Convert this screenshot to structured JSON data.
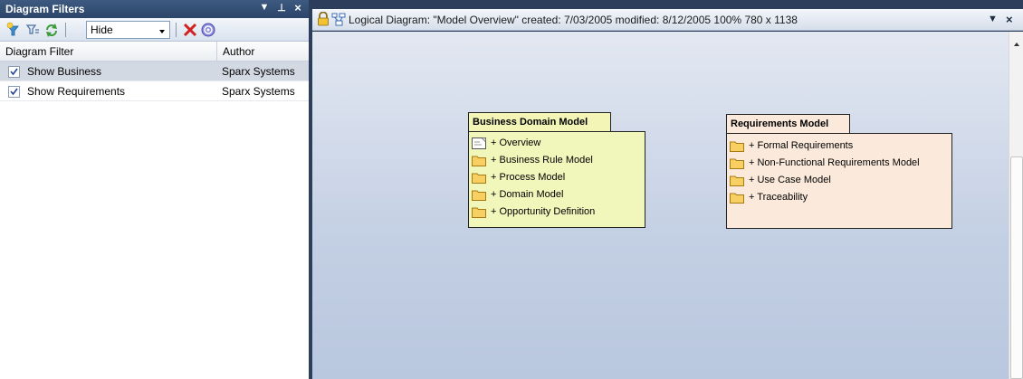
{
  "left_panel": {
    "title": "Diagram Filters",
    "controls": {
      "dropdown": "▼",
      "pin": "⊥",
      "close": "×"
    },
    "toolbar": {
      "select_value": "Hide",
      "buttons": [
        "new-filter-icon",
        "filter-options-icon",
        "refresh-icon",
        "delete-icon",
        "help-icon"
      ]
    },
    "columns": [
      "Diagram Filter",
      "Author"
    ],
    "rows": [
      {
        "label": "Show Business",
        "author": "Sparx Systems",
        "checked": true,
        "selected": true
      },
      {
        "label": "Show Requirements",
        "author": "Sparx Systems",
        "checked": true,
        "selected": false
      }
    ]
  },
  "diagram": {
    "title_text": "Logical Diagram: \"Model Overview\"   created: 7/03/2005  modified: 8/12/2005   100%   780 x 1138",
    "controls": {
      "dropdown": "▼",
      "close": "×"
    },
    "packages": [
      {
        "name": "Business Domain Model",
        "items": [
          {
            "icon": "diagram-icon",
            "label": "+ Overview"
          },
          {
            "icon": "folder-icon",
            "label": "+ Business Rule Model"
          },
          {
            "icon": "folder-icon",
            "label": "+ Process Model"
          },
          {
            "icon": "folder-icon",
            "label": "+ Domain Model"
          },
          {
            "icon": "folder-icon",
            "label": "+ Opportunity Definition"
          }
        ]
      },
      {
        "name": "Requirements Model",
        "items": [
          {
            "icon": "folder-icon",
            "label": "+ Formal Requirements"
          },
          {
            "icon": "folder-icon",
            "label": "+ Non-Functional Requirements Model"
          },
          {
            "icon": "folder-icon",
            "label": "+ Use Case Model"
          },
          {
            "icon": "folder-icon",
            "label": "+ Traceability"
          }
        ]
      }
    ]
  },
  "colors": {
    "panel_title_bg": "#2b4669",
    "business_package_bg": "#f1f6bb",
    "requirements_package_bg": "#fbeadb",
    "canvas_bg": "#c3cfe3",
    "selected_row_bg": "#d3d9e3"
  }
}
